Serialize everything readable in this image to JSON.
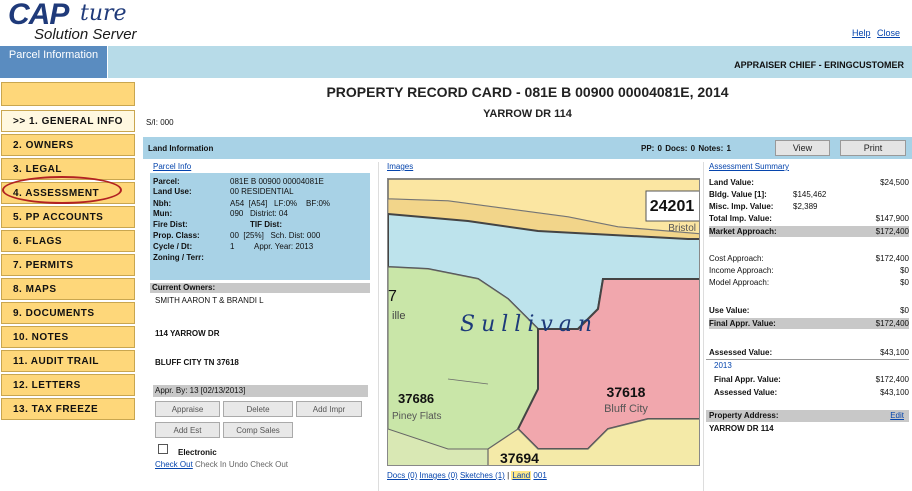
{
  "header": {
    "logo_main": "CAP",
    "logo_script": "ture",
    "logo_sub": "Solution Server",
    "help": "Help",
    "close": "Close",
    "parcel_tab": "Parcel Information",
    "user": "APPRAISER CHIEF - ERINGCUSTOMER"
  },
  "nav": [
    {
      "label": ">> 1. GENERAL INFO",
      "active": true
    },
    {
      "label": "2. OWNERS"
    },
    {
      "label": "3. LEGAL"
    },
    {
      "label": "4. ASSESSMENT"
    },
    {
      "label": "5. PP ACCOUNTS"
    },
    {
      "label": "6. FLAGS"
    },
    {
      "label": "7. PERMITS"
    },
    {
      "label": "8. MAPS"
    },
    {
      "label": "9. DOCUMENTS"
    },
    {
      "label": "10. NOTES"
    },
    {
      "label": "11. AUDIT TRAIL"
    },
    {
      "label": "12. LETTERS"
    },
    {
      "label": "13. TAX FREEZE"
    }
  ],
  "main": {
    "title": "PROPERTY RECORD CARD - 081E B 00900 00004081E, 2014",
    "address": "YARROW DR 114",
    "sn": "S/I: 000",
    "land_info": "Land Information",
    "counts": "PP: 0   Docs: 0   Notes: 1",
    "view": "View",
    "print": "Print"
  },
  "parcel_info": {
    "header": "Parcel Info",
    "parcel_l": "Parcel:",
    "parcel_v": "081E B 00900 00004081E",
    "landuse_l": "Land Use:",
    "landuse_v": "00 RESIDENTIAL",
    "nbh_l": "Nbh:",
    "nbh_v": "A54  [A54]   LF:0%    BF:0%",
    "mun_l": "Mun:",
    "mun_v": "090   District: 04",
    "fire_l": "Fire Dist:",
    "fire_v": "TIF Dist:",
    "propclass_l": "Prop. Class:",
    "propclass_v": "00  [25%]   Sch. Dist: 000",
    "cycle_l": "Cycle / Dt:",
    "cycle_v": "1         Appr. Year: 2013",
    "zoning_l": "Zoning / Terr:",
    "owners_header": "Current Owners:",
    "owner_name": "SMITH AARON T & BRANDI L",
    "owner_addr1": "114 YARROW DR",
    "owner_addr2": "BLUFF CITY TN 37618",
    "appr_by": "Appr. By: 13 [02/13/2013]",
    "btn_appraise": "Appraise",
    "btn_delete": "Delete",
    "btn_addimpr": "Add Impr",
    "btn_addest": "Add Est",
    "btn_compsales": "Comp Sales",
    "electronic": "Electronic",
    "checkout": "Check Out",
    "checkin": "Check In",
    "undo": "Undo Check Out"
  },
  "images": {
    "header": "Images",
    "map_text": {
      "sullivan": "Sullivan",
      "z1": "24201",
      "bristol": "Bristol",
      "z2": "37618",
      "bluff": "Bluff City",
      "z3": "37686",
      "piney": "Piney Flats",
      "z4": "37694",
      "ville": "ille",
      "seven": "7"
    },
    "links": {
      "docs": "Docs (0)",
      "images": "Images (0)",
      "sketches": "Sketches (1)",
      "sep": "|",
      "land": "Land",
      "num": "001"
    }
  },
  "assessment": {
    "header": "Assessment Summary",
    "land_l": "Land Value:",
    "land_v": "$24,500",
    "bldg_l": "Bldg. Value [1]:",
    "bldg_m": "$145,462",
    "misc_l": "Misc. Imp. Value:",
    "misc_m": "$2,389",
    "total_l": "Total Imp. Value:",
    "total_v": "$147,900",
    "market_l": "Market Approach:",
    "market_v": "$172,400",
    "cost_l": "Cost Approach:",
    "cost_v": "$172,400",
    "income_l": "Income Approach:",
    "income_v": "$0",
    "model_l": "Model Approach:",
    "model_v": "$0",
    "use_l": "Use Value:",
    "use_v": "$0",
    "final_l": "Final Appr. Value:",
    "final_v": "$172,400",
    "assessed_l": "Assessed Value:",
    "assessed_v": "$43,100",
    "year": "2013",
    "final2_l": "Final Appr. Value:",
    "final2_v": "$172,400",
    "assessed2_l": "Assessed Value:",
    "assessed2_v": "$43,100",
    "prop_addr_l": "Property Address:",
    "edit": "Edit",
    "prop_addr_v": "YARROW DR 114"
  }
}
